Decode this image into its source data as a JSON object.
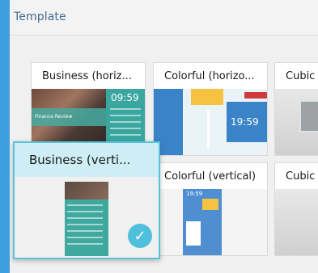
{
  "header": {
    "title": "Template"
  },
  "templates": [
    {
      "label": "Business (horiz..."
    },
    {
      "label": "Colorful (horizo..."
    },
    {
      "label": "Cubic"
    },
    {
      "label": "Business (verti...",
      "selected": true
    },
    {
      "label": "Colorful (vertical)"
    },
    {
      "label": "Cubic"
    }
  ],
  "thumb_text": {
    "business_time": "09:59",
    "business_caption": "Finance Review",
    "colorful_time": "19:59",
    "colorful_vertical_time": "19:59"
  },
  "colors": {
    "accent": "#3d9fe0",
    "selected_border": "#5bc2d9",
    "selected_header": "#cdeef4",
    "check": "#4ec0dc"
  }
}
